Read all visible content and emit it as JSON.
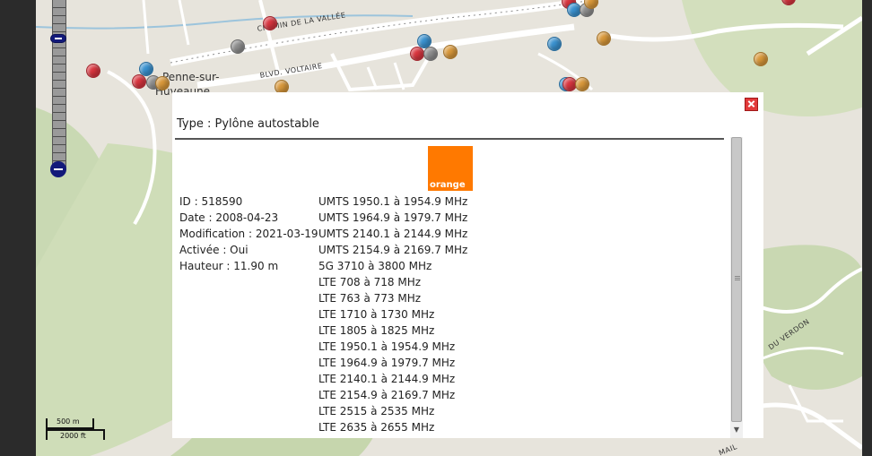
{
  "map": {
    "street_labels": {
      "chemin": "CHEMIN DE LA VALLÉE",
      "voltaire": "BLVD. VOLTAIRE",
      "verdon": "DU VERDON",
      "mail": "MAIL"
    },
    "town_labels": {
      "penne": "Penne-sur-",
      "huveaune": "Huveaune"
    },
    "marker_colors": {
      "red": "#d9353f",
      "orange": "#d9983a",
      "blue": "#3a92d0",
      "grey": "#8e8e8e"
    },
    "scale": {
      "metric": "500 m",
      "imperial": "2000 ft"
    }
  },
  "popup": {
    "type_line": "Type : Pylône autostable",
    "operator_logo": "orange",
    "operator_color": "#ff7900",
    "info": {
      "id": "ID : 518590",
      "date": "Date : 2008-04-23",
      "modification": "Modification : 2021-03-19",
      "activee": "Activée : Oui",
      "hauteur": "Hauteur : 11.90 m"
    },
    "frequencies": [
      "UMTS 1950.1 à 1954.9 MHz",
      "UMTS 1964.9 à 1979.7 MHz",
      "UMTS 2140.1 à 2144.9 MHz",
      "UMTS 2154.9 à 2169.7 MHz",
      "5G 3710 à 3800 MHz",
      "LTE 708 à 718 MHz",
      "LTE 763 à 773 MHz",
      "LTE 1710 à 1730 MHz",
      "LTE 1805 à 1825 MHz",
      "LTE 1950.1 à 1954.9 MHz",
      "LTE 1964.9 à 1979.7 MHz",
      "LTE 2140.1 à 2144.9 MHz",
      "LTE 2154.9 à 2169.7 MHz",
      "LTE 2515 à 2535 MHz",
      "LTE 2635 à 2655 MHz"
    ]
  }
}
